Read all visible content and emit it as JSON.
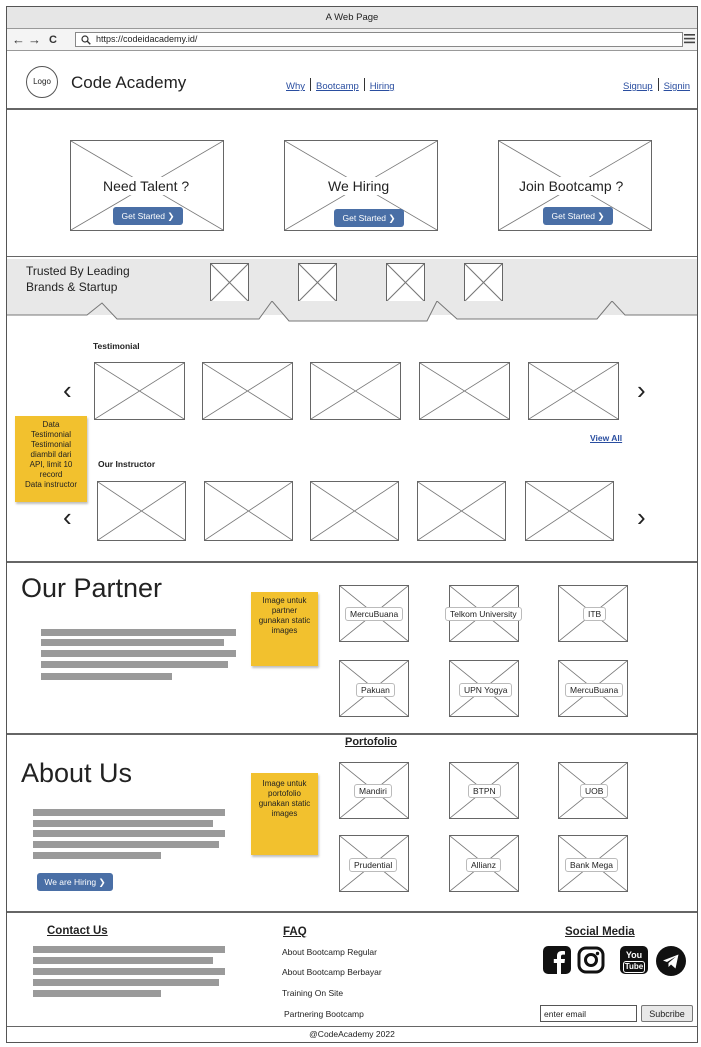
{
  "window": {
    "title": "A Web Page"
  },
  "browser": {
    "url": "https://codeidacademy.id/",
    "back": "←",
    "forward": "→",
    "reload": "C"
  },
  "header": {
    "logo": "Logo",
    "brand": "Code Academy",
    "nav": [
      "Why",
      "Bootcamp",
      "Hiring"
    ],
    "auth": [
      "Signup",
      "Signin"
    ]
  },
  "hero": [
    {
      "label": "Need Talent ?",
      "button": "Get Started"
    },
    {
      "label": "We Hiring",
      "button": "Get Started"
    },
    {
      "label": "Join Bootcamp ?",
      "button": "Get Started"
    }
  ],
  "trusted": {
    "title_line1": "Trusted By Leading",
    "title_line2": "Brands & Startup"
  },
  "testimonial": {
    "title": "Testimonial",
    "view_all": "View All"
  },
  "instructor": {
    "title": "Our Instructor"
  },
  "notes": {
    "testimonial": [
      "Data",
      "Testimonial",
      "Testimonial",
      "diambil dari",
      "API, limit 10",
      "record",
      "Data instructor"
    ],
    "partner": [
      "Image untuk",
      "partner",
      "gunakan static",
      "images"
    ],
    "portfolio": [
      "Image untuk",
      "portofolio",
      "gunakan static",
      "images"
    ]
  },
  "partner": {
    "title": "Our Partner",
    "items": [
      "MercuBuana",
      "Telkom University",
      "ITB",
      "Pakuan",
      "UPN Yogya",
      "MercuBuana"
    ]
  },
  "about": {
    "title": "About Us",
    "button": "We are Hiring",
    "portfolio_title": "Portofolio",
    "items": [
      "Mandiri",
      "BTPN",
      "UOB",
      "Prudential",
      "Allianz",
      "Bank Mega"
    ]
  },
  "footer": {
    "contact_title": "Contact Us",
    "faq_title": "FAQ",
    "faq": [
      "About Bootcamp Regular",
      "About Bootcamp Berbayar",
      "Training On Site",
      "Partnering Bootcamp"
    ],
    "social_title": "Social Media",
    "social_icons": [
      "facebook-icon",
      "instagram-icon",
      "youtube-icon",
      "telegram-icon"
    ],
    "youtube_text1": "You",
    "youtube_text2": "Tube",
    "email_placeholder": "enter email",
    "subscribe": "Subcribe",
    "copyright": "@CodeAcademy 2022"
  }
}
